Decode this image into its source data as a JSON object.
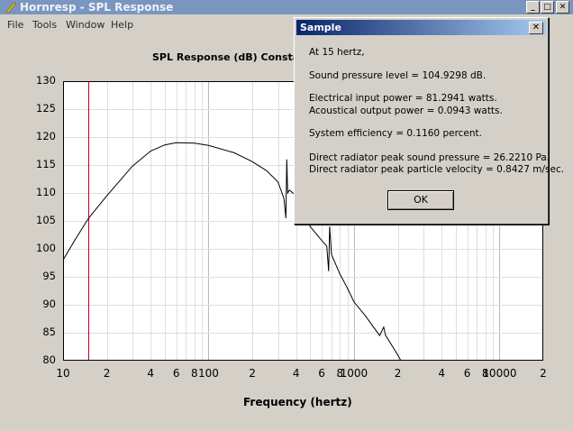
{
  "window": {
    "title": "Hornresp - SPL Response",
    "minimize_label": "_",
    "maximize_label": "□",
    "close_label": "✕"
  },
  "menu": [
    "File",
    "Tools",
    "Window",
    "Help"
  ],
  "chart_data": {
    "type": "line",
    "title": "SPL Response (dB)    Consta",
    "xlabel": "Frequency (hertz)",
    "ylabel": "",
    "xscale": "log",
    "xlim": [
      10,
      20000
    ],
    "ylim": [
      80,
      130
    ],
    "grid": true,
    "yticks": [
      "130",
      "125",
      "120",
      "115",
      "110",
      "105",
      "100",
      "95",
      "90",
      "85",
      "80"
    ],
    "xticks": [
      "10",
      "2",
      "4",
      "6",
      "8",
      "100",
      "2",
      "4",
      "6",
      "8",
      "1000",
      "2",
      "4",
      "6",
      "8",
      "10000",
      "2"
    ],
    "marker_x": 15,
    "series": [
      {
        "x": [
          10,
          12,
          15,
          20,
          30,
          40,
          50,
          60,
          80,
          100,
          150,
          200,
          250,
          300,
          330,
          340,
          345,
          350,
          360,
          400,
          500,
          600,
          650,
          670,
          680,
          700,
          800,
          900,
          1000,
          1200,
          1500,
          1600,
          1650,
          1700,
          2000,
          2100
        ],
        "y": [
          98,
          101.5,
          105.5,
          109.5,
          114.8,
          117.5,
          118.6,
          119,
          118.9,
          118.5,
          117.2,
          115.6,
          114,
          112,
          109,
          105.5,
          116,
          110,
          110.5,
          109.5,
          104,
          101.5,
          100.5,
          96,
          104,
          99,
          95.5,
          93,
          90.5,
          88,
          84.5,
          86,
          84.5,
          84,
          81,
          80
        ]
      }
    ]
  },
  "dialog": {
    "title": "Sample",
    "close_label": "✕",
    "lines": [
      "At 15 hertz,",
      "Sound pressure level = 104.9298 dB.",
      "Electrical input power = 81.2941 watts.",
      "Acoustical output power = 0.0943 watts.",
      "System efficiency = 0.1160 percent.",
      "Direct radiator peak sound pressure = 26.2210 Pa.",
      "Direct radiator peak particle velocity = 0.8427 m/sec."
    ],
    "ok_label": "OK"
  }
}
